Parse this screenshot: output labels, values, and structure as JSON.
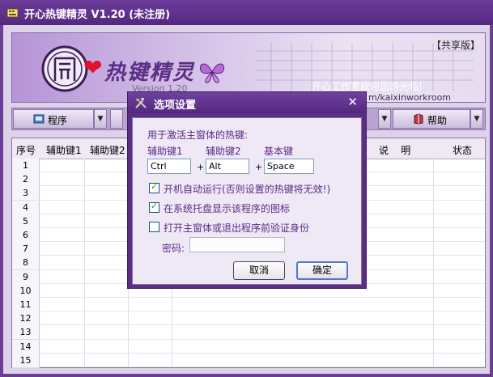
{
  "window": {
    "title": "开心热键精灵  V1.20 (未注册)"
  },
  "banner": {
    "title": "热键精灵",
    "version": "Version 1.20",
    "share_badge": "【共享版】",
    "welcome": "开心工作室欢迎您的光临!",
    "url": "m/kaixinworkroom"
  },
  "toolbar": {
    "program_label": "程序",
    "help_label": "帮助"
  },
  "table": {
    "headers": [
      "序号",
      "辅助键1",
      "辅助键2",
      "说    明",
      "状态"
    ],
    "rows": [
      "1",
      "2",
      "3",
      "4",
      "5",
      "6",
      "7",
      "8",
      "9",
      "10",
      "11",
      "12",
      "13",
      "14",
      "15"
    ]
  },
  "dialog": {
    "title": "选项设置",
    "close": "✕",
    "hotkey_label": "用于激活主窗体的热键:",
    "col1": "辅助键1",
    "col2": "辅助键2",
    "col3": "基本键",
    "key1": "Ctrl",
    "key2": "Alt",
    "key3": "Space",
    "plus": "+",
    "autorun": {
      "label": "开机自动运行(否则设置的热键将无效!)",
      "checked": true
    },
    "tray": {
      "label": "在系统托盘显示该程序的图标",
      "checked": true
    },
    "verify": {
      "label": "打开主窗体或退出程序前验证身份",
      "checked": false
    },
    "password_label": "密码:",
    "password_value": "",
    "cancel": "取消",
    "ok": "确定"
  }
}
